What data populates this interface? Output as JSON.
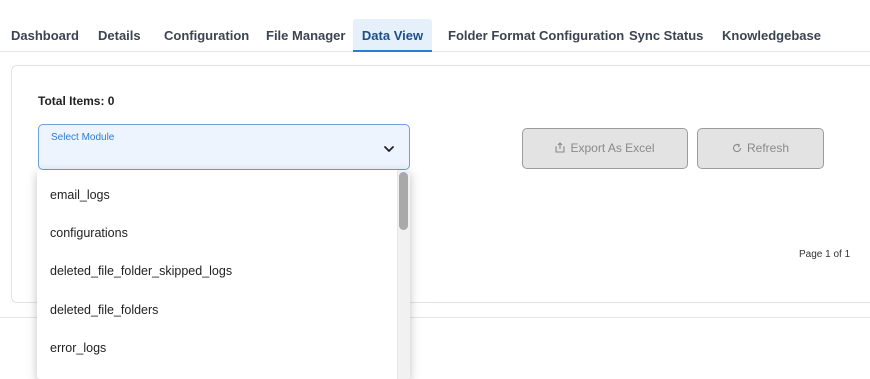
{
  "tabs": [
    {
      "label": "Dashboard"
    },
    {
      "label": "Details"
    },
    {
      "label": "Configuration"
    },
    {
      "label": "File Manager"
    },
    {
      "label": "Data View"
    },
    {
      "label": "Folder Format Configuration"
    },
    {
      "label": "Sync Status"
    },
    {
      "label": "Knowledgebase"
    }
  ],
  "active_tab": "Data View",
  "summary": {
    "total_label": "Total Items:",
    "total_value": "0"
  },
  "module_select": {
    "label": "Select Module",
    "value": "",
    "options": [
      "email_logs",
      "configurations",
      "deleted_file_folder_skipped_logs",
      "deleted_file_folders",
      "error_logs"
    ]
  },
  "buttons": {
    "export_label": "Export As Excel",
    "export_icon": "share-icon",
    "refresh_label": "Refresh",
    "refresh_icon": "refresh-icon"
  },
  "pagination": {
    "text": "Page 1 of 1"
  },
  "colors": {
    "accent": "#2f7bd1",
    "active_tab_bg": "#e6f0fb",
    "button_bg": "#e3e3e3"
  }
}
